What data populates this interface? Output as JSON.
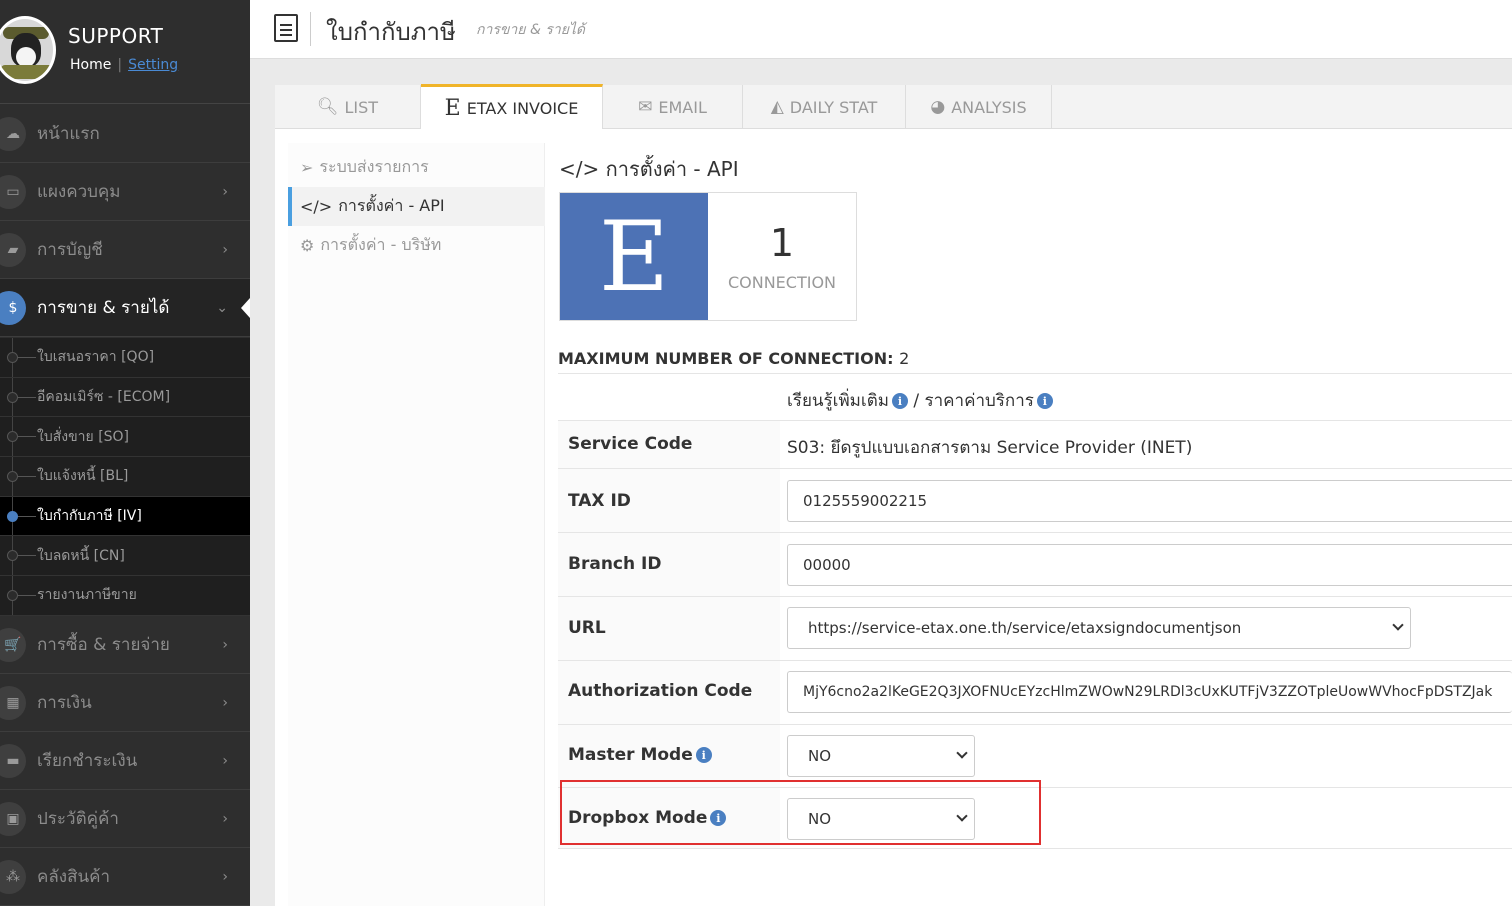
{
  "brand": {
    "title": "SUPPORT",
    "home": "Home",
    "separator": "|",
    "setting": "Setting"
  },
  "sidebar": {
    "items": [
      {
        "label": "หน้าแรก",
        "icon": "cloud-icon"
      },
      {
        "label": "แผงควบคุม",
        "icon": "monitor-icon"
      },
      {
        "label": "การบัญชี",
        "icon": "book-icon"
      },
      {
        "label": "การขาย & รายได้",
        "icon": "dollar-icon"
      },
      {
        "label": "การซื้อ & รายจ่าย",
        "icon": "cart-icon"
      },
      {
        "label": "การเงิน",
        "icon": "calendar-icon"
      },
      {
        "label": "เรียกชำระเงิน",
        "icon": "credit-card-icon"
      },
      {
        "label": "ประวัติคู่ค้า",
        "icon": "contact-icon"
      },
      {
        "label": "คลังสินค้า",
        "icon": "boxes-icon"
      }
    ],
    "sub_items": [
      "ใบเสนอราคา [QO]",
      "อีคอมเมิร์ซ - [ECOM]",
      "ใบสั่งขาย [SO]",
      "ใบแจ้งหนี้ [BL]",
      "ใบกำกับภาษี [IV]",
      "ใบลดหนี้ [CN]",
      "รายงานภาษีขาย"
    ]
  },
  "header": {
    "title": "ใบกำกับภาษี",
    "subtitle": "การขาย & รายได้"
  },
  "tabs": [
    "LIST",
    "ETAX INVOICE",
    "EMAIL",
    "DAILY STAT",
    "ANALYSIS"
  ],
  "leftnav": [
    "ระบบส่งรายการ",
    "การตั้งค่า - API",
    "การตั้งค่า - บริษัท"
  ],
  "section": {
    "title": "การตั้งค่า - API"
  },
  "stat": {
    "logo": "E",
    "count": "1",
    "label": "CONNECTION"
  },
  "maxconn": {
    "label": "MAXIMUM NUMBER OF CONNECTION:",
    "value": "2"
  },
  "links": {
    "learn_more": "เรียนรู้เพิ่มเติม",
    "slash": "/",
    "pricing": "ราคาค่าบริการ"
  },
  "form": {
    "service_code_label": "Service Code",
    "service_code_value": "S03: ยึดรูปแบบเอกสารตาม Service Provider (INET)",
    "tax_id_label": "TAX ID",
    "tax_id_value": "0125559002215",
    "branch_label": "Branch ID",
    "branch_value": "00000",
    "url_label": "URL",
    "url_value": "https://service-etax.one.th/service/etaxsigndocumentjson",
    "auth_label": "Authorization Code",
    "auth_value": "MjY6cno2a2lKeGE2Q3JXOFNUcEYzcHlmZWOwN29LRDl3cUxKUTFjV3ZZOTpleUowWVhocFpDSTZJak",
    "master_label": "Master Mode",
    "master_value": "NO",
    "dropbox_label": "Dropbox Mode",
    "dropbox_value": "NO"
  },
  "colors": {
    "accent": "#4a7fc1",
    "tab_active": "#f0b429",
    "highlight": "#e03030",
    "sidebar": "#2e2e2e"
  }
}
